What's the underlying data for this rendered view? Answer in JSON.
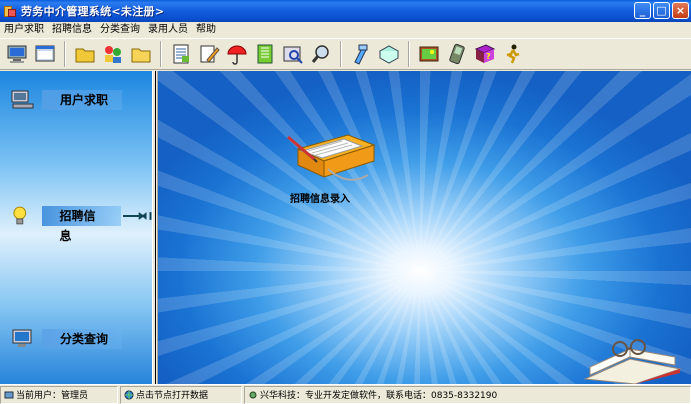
{
  "window": {
    "title": "劳务中介管理系统<未注册>",
    "buttons": [
      "_",
      "□",
      "×"
    ]
  },
  "menu": [
    "用户求职",
    "招聘信息",
    "分类查询",
    "录用人员",
    "帮助"
  ],
  "toolbar": {
    "group1": [
      "monitor-icon",
      "window-icon"
    ],
    "group2": [
      "folder-icon",
      "people-icon",
      "folder-open-icon",
      "report-icon",
      "edit-icon",
      "umbrella-icon",
      "notebook-icon",
      "preview-icon",
      "search-icon",
      "hammer-icon",
      "book-icon",
      "picture-icon",
      "pda-icon",
      "help-icon",
      "exit-icon"
    ]
  },
  "sidebar": {
    "items": [
      {
        "label": "用户求职",
        "icon": "computer-icon"
      },
      {
        "label": "招聘信息",
        "icon": "bulb-icon",
        "active": true
      },
      {
        "label": "分类查询",
        "icon": "monitor-icon"
      }
    ]
  },
  "content": {
    "icon_label": "招聘信息录入"
  },
  "status": {
    "user": "当前用户：管理员",
    "hint": "点击节点打开数据",
    "company": "兴华科技：专业开发定做软件，联系电话：0835-8332190"
  },
  "colors": {
    "titlebar": "#0a5fd8",
    "background": "#1a73d3",
    "chrome": "#ece9d8"
  }
}
